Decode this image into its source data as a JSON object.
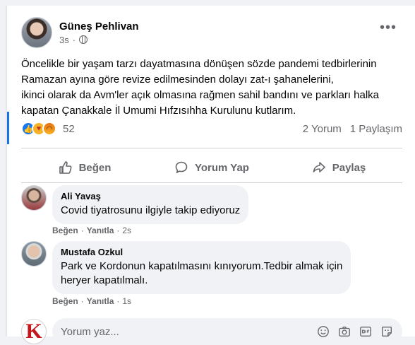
{
  "post": {
    "author": "Güneş Pehlivan",
    "time": "3s",
    "text_lines": [
      "Öncelikle bir yaşam tarzı dayatmasına dönüşen sözde pandemi tedbirlerinin",
      "Ramazan ayına göre revize edilmesinden dolayı zat-ı şahanelerini,",
      "ikinci olarak da Avm'ler açık olmasına rağmen sahil bandını ve parkları halka",
      "kapatan Çanakkale İl Umumi Hıfzısıhha Kurulunu kutlarım."
    ],
    "reaction_count": "52",
    "comments_count": "2 Yorum",
    "shares_count": "1 Paylaşım",
    "more_glyph": "•••"
  },
  "actions": {
    "like": "Beğen",
    "comment": "Yorum Yap",
    "share": "Paylaş"
  },
  "comments": [
    {
      "name": "Ali Yavaş",
      "text_lines": [
        "Covid tiyatrosunu ilgiyle takip ediyoruz"
      ],
      "like": "Beğen",
      "reply": "Yanıtla",
      "time": "2s"
    },
    {
      "name": "Mustafa Ozkul",
      "text_lines": [
        "Park ve Kordonun kapatılmasını kınıyorum.Tedbir almak için",
        "heryer kapatılmalı."
      ],
      "like": "Beğen",
      "reply": "Yanıtla",
      "time": "1s"
    }
  ],
  "composer": {
    "placeholder": "Yorum yaz...",
    "avatar_letter": "K"
  },
  "separator": "·",
  "colors": {
    "accent": "#1877f2",
    "muted": "#65676b",
    "bubble": "#f0f2f5"
  },
  "icons": [
    "globe-icon",
    "more-icon",
    "like-icon",
    "comment-icon",
    "share-icon",
    "emoji-icon",
    "camera-icon",
    "gif-icon",
    "sticker-icon"
  ]
}
